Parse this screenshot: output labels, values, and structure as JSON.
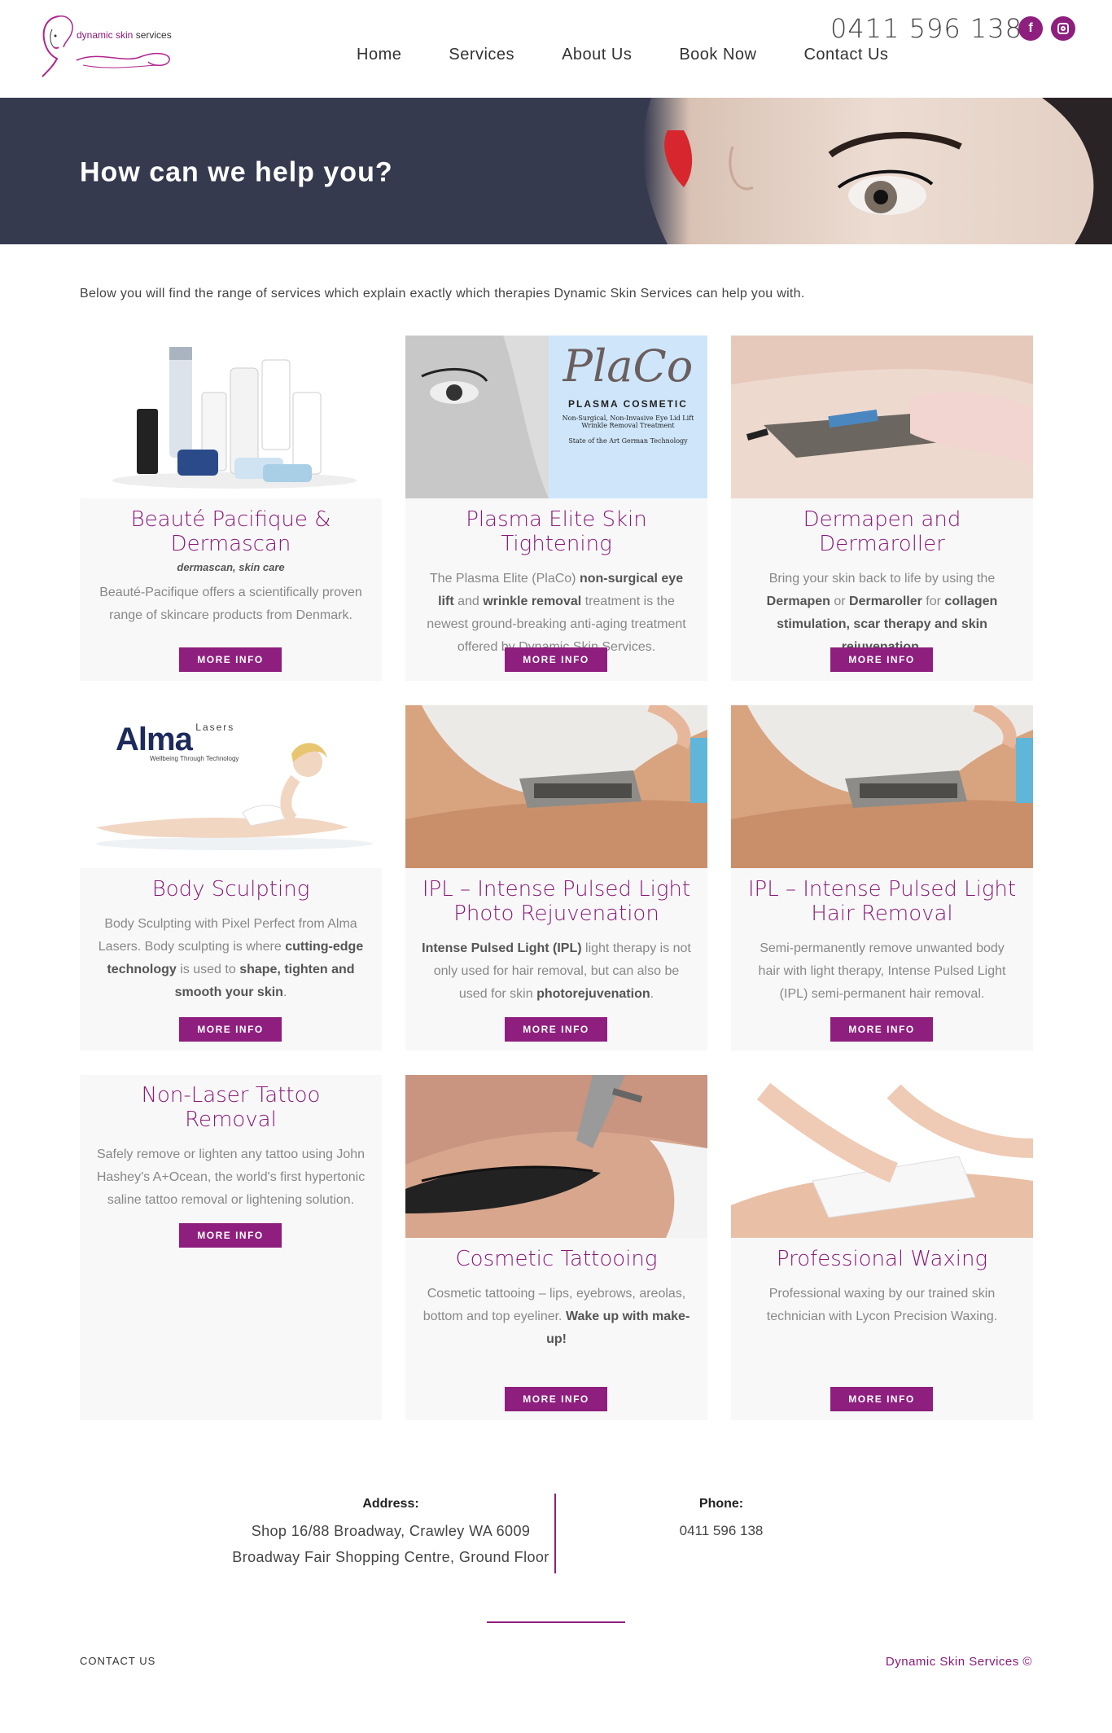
{
  "header": {
    "logo_text_1": "dynamic skin",
    "logo_text_2": " services",
    "phone": "0411 596 138",
    "nav": [
      "Home",
      "Services",
      "About Us",
      "Book Now",
      "Contact Us"
    ],
    "social": [
      "facebook-icon",
      "instagram-icon"
    ]
  },
  "banner": {
    "title": "How can we help you?"
  },
  "intro": "Below you will find the range of services which explain exactly which therapies Dynamic Skin Services can help you with.",
  "button_label": "MORE INFO",
  "services": [
    {
      "title": "Beauté Pacifique & Dermascan",
      "tags": "dermascan, skin care",
      "desc": "Beauté-Pacifique offers a scientifically proven range of skincare products from Denmark."
    },
    {
      "title": "Plasma Elite Skin Tightening",
      "desc_parts": [
        "The Plasma Elite (PlaCo) ",
        "non-surgical eye lift",
        " and ",
        "wrinkle removal",
        " treatment is the newest ground-breaking anti-aging treatment offered by Dynamic Skin Services."
      ],
      "img_text": {
        "logo": "PlaCo",
        "brand": "PLASMA COSMETIC",
        "line1": "Non-Surgical, Non-Invasive Eye Lid Lift",
        "line2": "Wrinkle Removal Treatment",
        "line3": "State of the Art German Technology"
      }
    },
    {
      "title": "Dermapen and Dermaroller",
      "desc_parts": [
        "Bring your skin back to life by using the ",
        "Dermapen",
        " or ",
        "Dermaroller",
        " for ",
        "collagen stimulation, scar therapy and skin rejuvenation",
        "."
      ]
    },
    {
      "title": "Body Sculpting",
      "desc_parts": [
        "Body Sculpting with Pixel Perfect from Alma Lasers. Body sculpting is where ",
        "cutting-edge technology",
        " is used to ",
        "shape, tighten and smooth your skin",
        "."
      ],
      "img_text": {
        "brand": "Alma",
        "sub": "Lasers",
        "tagline": "Wellbeing Through Technology"
      }
    },
    {
      "title": "IPL – Intense Pulsed Light Photo Rejuvenation",
      "desc_parts": [
        "",
        "Intense Pulsed Light (IPL)",
        " light therapy is not only used for hair removal, but can also be used for skin ",
        "photorejuvenation",
        "."
      ]
    },
    {
      "title": "IPL – Intense Pulsed Light Hair Removal",
      "desc": "Semi-permanently remove unwanted body hair with light therapy, Intense Pulsed Light (IPL) semi-permanent hair removal."
    },
    {
      "title": "Non-Laser Tattoo Removal",
      "desc": "Safely remove or lighten any tattoo using John Hashey's A+Ocean, the world's first hypertonic saline tattoo removal or lightening solution."
    },
    {
      "title": "Cosmetic Tattooing",
      "desc_parts": [
        "Cosmetic tattooing – lips, eyebrows, areolas, bottom and top eyeliner. ",
        "Wake up with make-up!",
        ""
      ]
    },
    {
      "title": "Professional Waxing",
      "desc": "Professional waxing by our trained skin technician with Lycon Precision Waxing."
    }
  ],
  "footer": {
    "address_label": "Address:",
    "address_line1": "Shop 16/88 Broadway, Crawley WA 6009",
    "address_line2": "Broadway Fair Shopping Centre, Ground Floor",
    "phone_label": "Phone:",
    "phone": "0411 596 138",
    "contact_link": "CONTACT US",
    "copyright": "Dynamic Skin Services ©"
  },
  "colors": {
    "accent": "#8e1f7e",
    "banner": "#353a4f"
  }
}
